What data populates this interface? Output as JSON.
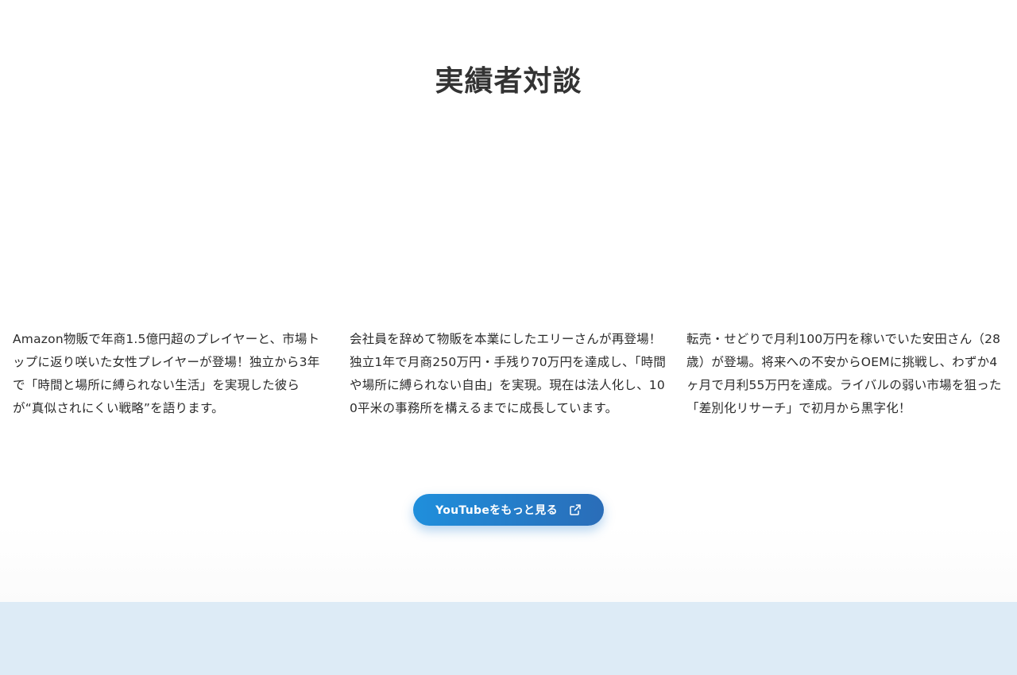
{
  "section": {
    "title": "実績者対談"
  },
  "cards": [
    {
      "description": "Amazon物販で年商1.5億円超のプレイヤーと、市場トップに返り咲いた女性プレイヤーが登場！独立から3年で「時間と場所に縛られない生活」を実現した彼らが“真似されにくい戦略”を語ります。"
    },
    {
      "description": "会社員を辞めて物販を本業にしたエリーさんが再登場！独立1年で月商250万円・手残り70万円を達成し、「時間や場所に縛られない自由」を実現。現在は法人化し、100平米の事務所を構えるまでに成長しています。"
    },
    {
      "description": "転売・せどりで月利100万円を稼いでいた安田さん（28歳）が登場。将来への不安からOEMに挑戦し、わずか4ヶ月で月利55万円を達成。ライバルの弱い市場を狙った「差別化リサーチ」で初月から黒字化！"
    }
  ],
  "cta": {
    "label": "YouTubeをもっと見る",
    "icon": "external-link-icon"
  },
  "colors": {
    "button_start": "#1f8fdc",
    "button_end": "#2a6db8",
    "footer_band": "#ddebf6",
    "title_text": "#333333"
  }
}
